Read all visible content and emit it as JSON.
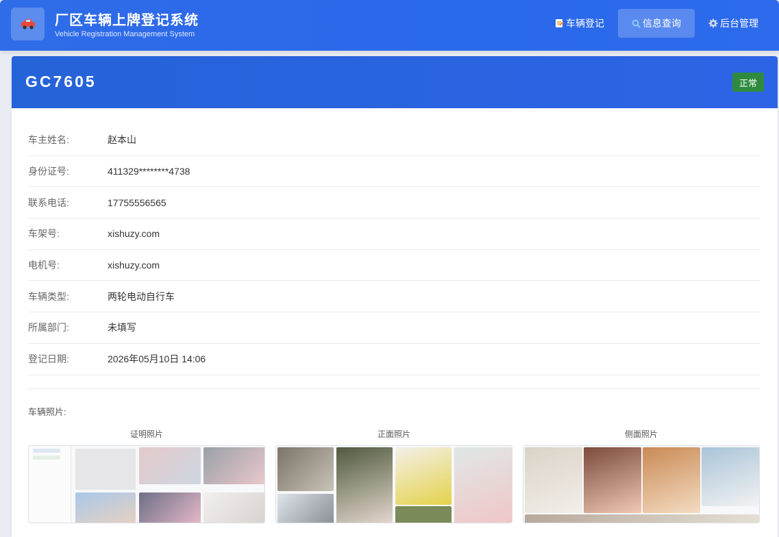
{
  "header": {
    "title": "厂区车辆上牌登记系统",
    "subtitle": "Vehicle Registration Management System",
    "logo_icon": "car-icon"
  },
  "nav": {
    "items": [
      {
        "label": "车辆登记",
        "icon": "memo-icon",
        "active": false
      },
      {
        "label": "信息查询",
        "icon": "search-icon",
        "active": true
      },
      {
        "label": "后台管理",
        "icon": "gear-icon",
        "active": false
      }
    ]
  },
  "record": {
    "plate": "GC7605",
    "status": "正常",
    "status_color": "#2e8b3e"
  },
  "fields": [
    {
      "label": "车主姓名:",
      "value": "赵本山"
    },
    {
      "label": "身份证号:",
      "value": "411329********4738"
    },
    {
      "label": "联系电话:",
      "value": "17755556565"
    },
    {
      "label": "车架号:",
      "value": "xishuzy.com"
    },
    {
      "label": "电机号:",
      "value": "xishuzy.com"
    },
    {
      "label": "车辆类型:",
      "value": "两轮电动自行车"
    },
    {
      "label": "所属部门:",
      "value": "未填写"
    },
    {
      "label": "登记日期:",
      "value": "2026年05月10日 14:06"
    }
  ],
  "photos": {
    "label": "车辆照片:",
    "items": [
      {
        "caption": "证明照片"
      },
      {
        "caption": "正面照片"
      },
      {
        "caption": "侧面照片"
      }
    ]
  },
  "colors": {
    "primary": "#2f6ce8",
    "status_green": "#2e8b3e"
  }
}
